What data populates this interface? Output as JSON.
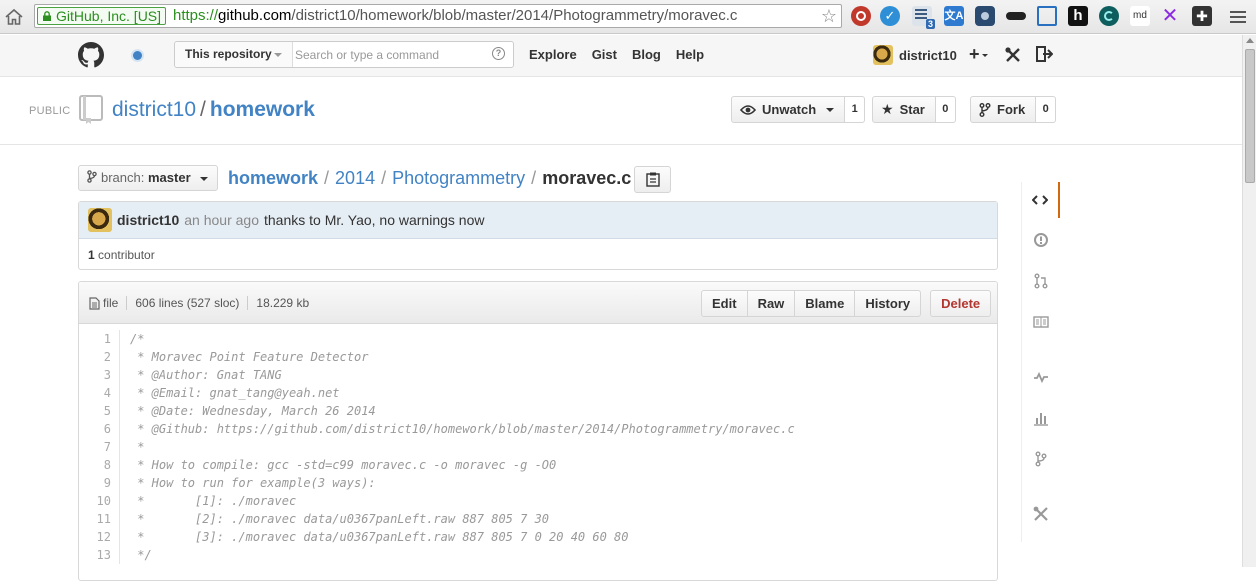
{
  "browser": {
    "ev_label": "GitHub, Inc. [US]",
    "url_protocol": "https://",
    "url_host": "github.com",
    "url_path": "/district10/homework/blob/master/2014/Photogrammetry/moravec.c",
    "extensions": [
      "ublock-icon",
      "v-icon",
      "feed-icon",
      "translate-icon",
      "camera-icon",
      "mask-icon",
      "screen-icon",
      "hn-icon",
      "wave-icon",
      "md-icon",
      "x-icon",
      "puzzle-icon"
    ],
    "md_label": "md",
    "hn_label": "h",
    "feed_badge": "3"
  },
  "header": {
    "search_scope": "This repository",
    "search_placeholder": "Search or type a command",
    "search_help": "?",
    "nav": [
      "Explore",
      "Gist",
      "Blog",
      "Help"
    ],
    "username": "district10",
    "plus": "+"
  },
  "repo": {
    "visibility": "PUBLIC",
    "owner": "district10",
    "separator": "/",
    "name": "homework",
    "unwatch_label": "Unwatch",
    "unwatch_count": "1",
    "star_label": "Star",
    "star_count": "0",
    "fork_label": "Fork",
    "fork_count": "0"
  },
  "file_nav": {
    "branch_label": "branch:",
    "branch_value": "master",
    "crumbs": [
      "homework",
      "2014",
      "Photogrammetry"
    ],
    "current": "moravec.c",
    "sep": "/"
  },
  "commit": {
    "author": "district10",
    "time": "an hour ago",
    "message": "thanks to Mr. Yao, no warnings now",
    "contributors_count": "1",
    "contributors_label": "contributor"
  },
  "file": {
    "label": "file",
    "lines": "606 lines (527 sloc)",
    "size": "18.229 kb",
    "actions": [
      "Edit",
      "Raw",
      "Blame",
      "History"
    ],
    "delete_label": "Delete",
    "code": [
      {
        "n": "1",
        "t": "/*"
      },
      {
        "n": "2",
        "t": " * Moravec Point Feature Detector"
      },
      {
        "n": "3",
        "t": " * @Author: Gnat TANG"
      },
      {
        "n": "4",
        "t": " * @Email: gnat_tang@yeah.net"
      },
      {
        "n": "5",
        "t": " * @Date: Wednesday, March 26 2014"
      },
      {
        "n": "6",
        "t": " * @Github: https://github.com/district10/homework/blob/master/2014/Photogrammetry/moravec.c"
      },
      {
        "n": "7",
        "t": " *"
      },
      {
        "n": "8",
        "t": " * How to compile: gcc -std=c99 moravec.c -o moravec -g -O0"
      },
      {
        "n": "9",
        "t": " * How to run for example(3 ways):"
      },
      {
        "n": "10",
        "t": " *       [1]: ./moravec"
      },
      {
        "n": "11",
        "t": " *       [2]: ./moravec data/u0367panLeft.raw 887 805 7 30"
      },
      {
        "n": "12",
        "t": " *       [3]: ./moravec data/u0367panLeft.raw 887 805 7 0 20 40 60 80"
      },
      {
        "n": "13",
        "t": " */"
      }
    ]
  },
  "repo_nav": [
    "code-icon",
    "issues-icon",
    "pull-requests-icon",
    "wiki-icon",
    "pulse-icon",
    "graphs-icon",
    "network-icon",
    "settings-icon"
  ],
  "colors": {
    "link": "#4183c4",
    "ev_green": "#2a8f1e",
    "danger": "#b33630",
    "nav_accent": "#d26911",
    "commit_bg": "#e6eef5"
  }
}
